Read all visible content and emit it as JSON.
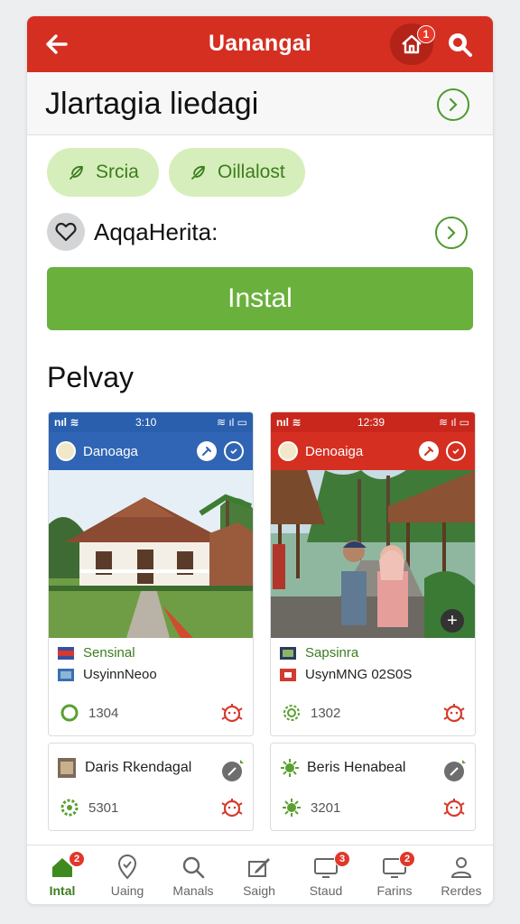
{
  "colors": {
    "brand_red": "#d52f22",
    "accent_green": "#6ab03c",
    "chip_bg": "#d6eebb",
    "card_blue": "#2f65b4"
  },
  "topbar": {
    "title": "Uanangai",
    "back_icon": "arrow-left-icon",
    "home_badge": "1",
    "home_icon": "home-icon",
    "search_icon": "search-icon"
  },
  "header": {
    "heading": "Jlartagia liedagi"
  },
  "chips": [
    {
      "label": "Srcia",
      "icon": "leaf-icon"
    },
    {
      "label": "Oillalost",
      "icon": "leaf-icon"
    }
  ],
  "favorite": {
    "label": "AqqaHerita:"
  },
  "install_button": {
    "label": "Instal"
  },
  "section": {
    "title": "Pelvay"
  },
  "cards": [
    {
      "status_time": "3:10",
      "app_name": "Danoaga",
      "row1": "Sensinal",
      "row2": "UsyinnNeoo",
      "count": "1304"
    },
    {
      "status_time": "12:39",
      "app_name": "Denoaiga",
      "row1": "Sapsinra",
      "row2": "UsynMNG 02S0S",
      "count": "1302"
    }
  ],
  "mini_cards": [
    {
      "name": "Daris Rkendagal",
      "count": "5301"
    },
    {
      "name": "Beris Henabeal",
      "count": "3201"
    }
  ],
  "bottom_nav": [
    {
      "label": "Intal",
      "icon": "home-icon",
      "badge": "2",
      "active": true
    },
    {
      "label": "Uaing",
      "icon": "location-icon",
      "badge": "",
      "active": false
    },
    {
      "label": "Manals",
      "icon": "search-icon",
      "badge": "",
      "active": false
    },
    {
      "label": "Saigh",
      "icon": "edit-icon",
      "badge": "",
      "active": false
    },
    {
      "label": "Staud",
      "icon": "monitor-icon",
      "badge": "3",
      "active": false
    },
    {
      "label": "Farins",
      "icon": "monitor-icon",
      "badge": "2",
      "active": false
    },
    {
      "label": "Rerdes",
      "icon": "person-icon",
      "badge": "",
      "active": false
    }
  ]
}
